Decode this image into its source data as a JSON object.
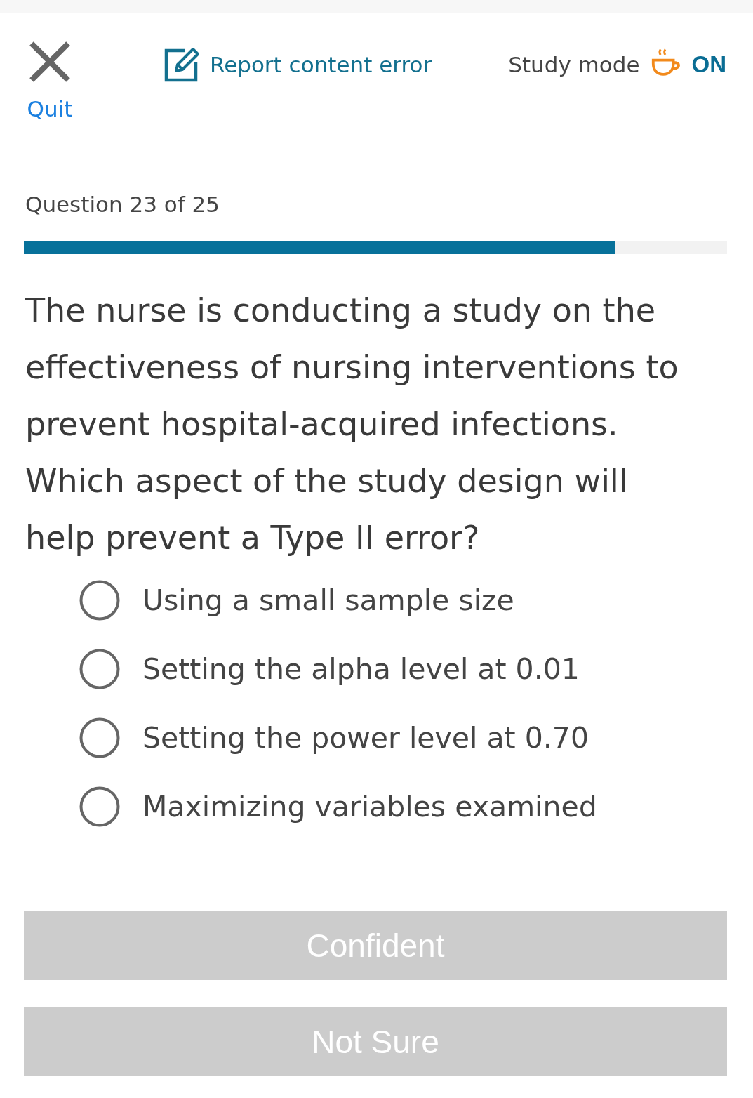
{
  "header": {
    "quit": {
      "label": "Quit"
    },
    "report": {
      "label": "Report content error"
    },
    "study_mode": {
      "label": "Study mode",
      "value": "ON",
      "on": true
    }
  },
  "progress": {
    "label": "Question 23 of 25",
    "level": 0.84
  },
  "question": {
    "text": "The nurse is conducting a study on the effectiveness of nursing interventions to prevent hospital-acquired infections. Which aspect of the study design will help prevent a Type II error?"
  },
  "options": [
    {
      "label": "Using a small sample size",
      "selected": false
    },
    {
      "label": "Setting the alpha level at 0.01",
      "selected": false
    },
    {
      "label": "Setting the power level at 0.70",
      "selected": false
    },
    {
      "label": "Maximizing variables examined",
      "selected": false
    }
  ],
  "buttons": [
    {
      "label": "Confident",
      "disabled": true
    },
    {
      "label": "Not Sure",
      "disabled": true
    }
  ]
}
